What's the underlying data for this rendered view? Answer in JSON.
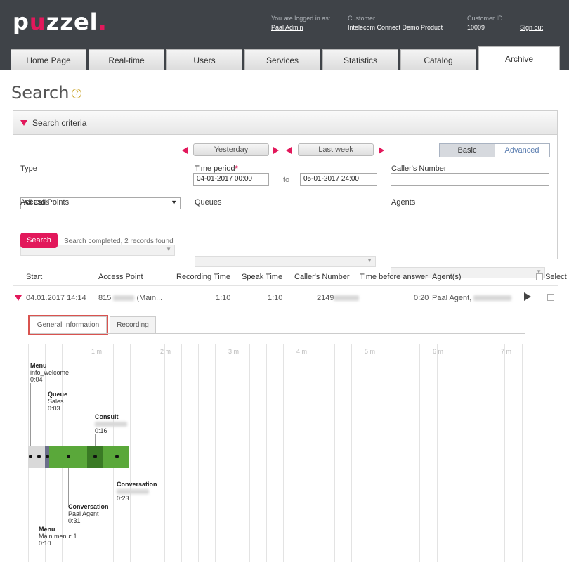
{
  "header": {
    "logo_prefix": "p",
    "logo_u": "u",
    "logo_rest": "zzel",
    "logo_dot": ".",
    "logged_in_label": "You are logged in as:",
    "logged_in_user": "Paal Admin",
    "customer_label": "Customer",
    "customer_name": "Intelecom Connect Demo Product",
    "customer_id_label": "Customer ID",
    "customer_id": "10009",
    "sign_out": "Sign out"
  },
  "tabs": [
    {
      "label": "Home Page"
    },
    {
      "label": "Real-time"
    },
    {
      "label": "Users"
    },
    {
      "label": "Services"
    },
    {
      "label": "Statistics"
    },
    {
      "label": "Catalog"
    },
    {
      "label": "Archive"
    }
  ],
  "page": {
    "title": "Search",
    "help_glyph": "?"
  },
  "criteria": {
    "title": "Search criteria",
    "yesterday": "Yesterday",
    "last_week": "Last week",
    "basic": "Basic",
    "advanced": "Advanced",
    "type_label": "Type",
    "type_value": "All Calls",
    "time_period_label": "Time period",
    "time_from": "04-01-2017 00:00",
    "to_label": "to",
    "time_to": "05-01-2017 24:00",
    "callers_number_label": "Caller's Number",
    "callers_number_value": "",
    "access_points_label": "Access Points",
    "queues_label": "Queues",
    "agents_label": "Agents",
    "search_button": "Search",
    "status": "Search completed, 2 records found"
  },
  "results": {
    "columns": [
      "Start",
      "Access Point",
      "Recording Time",
      "Speak Time",
      "Caller's Number",
      "Time before answer",
      "Agent(s)",
      "Select"
    ],
    "row": {
      "start": "04.01.2017 14:14",
      "access_point": "815",
      "access_point_suffix": "(Main...",
      "recording_time": "1:10",
      "speak_time": "1:10",
      "callers_number": "2149",
      "time_before_answer": "0:20",
      "agents": "Paal Agent,"
    }
  },
  "subtabs": {
    "general": "General Information",
    "recording": "Recording"
  },
  "timeline": {
    "ticks": [
      "1 m",
      "2 m",
      "3 m",
      "4 m",
      "5 m",
      "6 m",
      "7 m"
    ],
    "events": [
      {
        "title": "Menu",
        "detail": "info_welcome",
        "time": "0:04"
      },
      {
        "title": "Queue",
        "detail": "Sales",
        "time": "0:03"
      },
      {
        "title": "Consult",
        "detail": "",
        "time": "0:16"
      },
      {
        "title": "Conversation",
        "detail": "",
        "time": "0:23"
      },
      {
        "title": "Conversation",
        "detail": "Paal Agent",
        "time": "0:31"
      },
      {
        "title": "Menu",
        "detail": "Main menu: 1",
        "time": "0:10"
      }
    ],
    "colors": {
      "menu": "#d9d9d9",
      "queue": "#6b6f8a",
      "conversation": "#5aa83a",
      "consult": "#3a7a25"
    }
  }
}
